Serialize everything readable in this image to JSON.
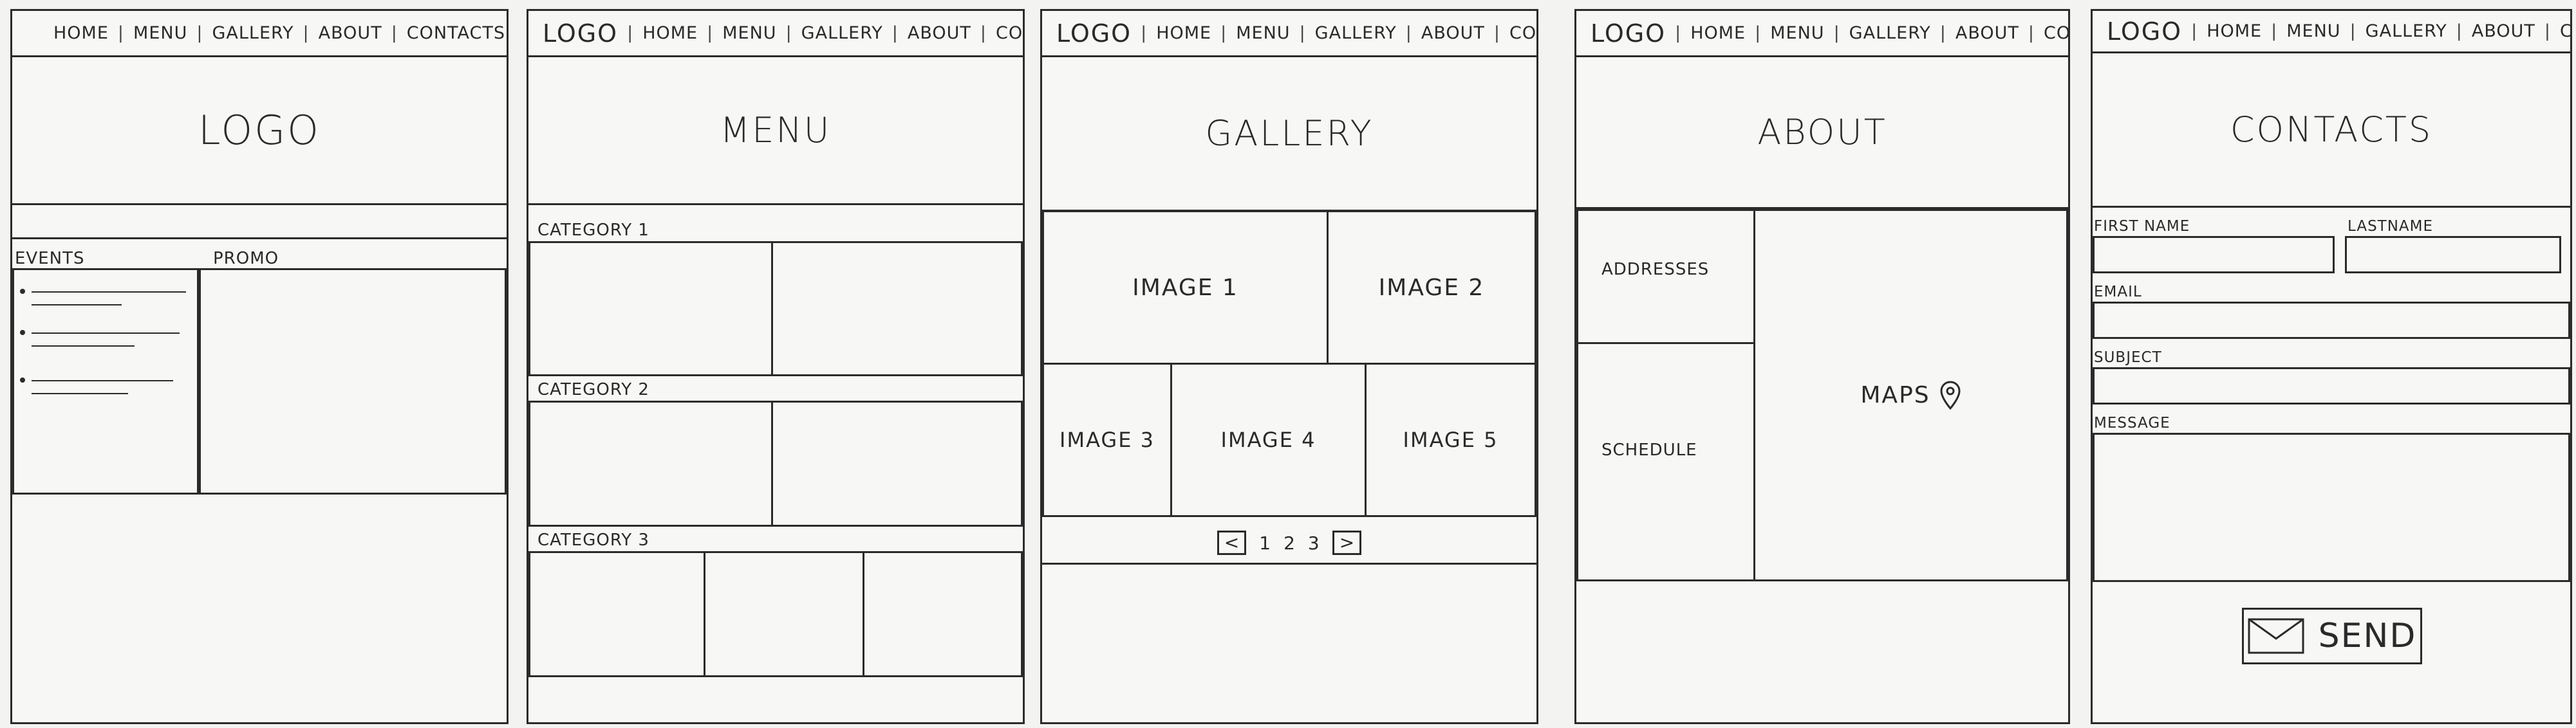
{
  "nav": {
    "logo": "LOGO",
    "home": "HOME",
    "menu": "MENU",
    "gallery": "GALLERY",
    "about": "ABOUT",
    "contacts": "CONTACTS",
    "sep": "|"
  },
  "home": {
    "hero": "LOGO",
    "events": "EVENTS",
    "promo": "PROMO"
  },
  "menu": {
    "hero": "MENU",
    "cat1": "CATEGORY 1",
    "cat2": "CATEGORY 2",
    "cat3": "CATEGORY 3"
  },
  "gallery": {
    "hero": "GALLERY",
    "images": [
      "IMAGE 1",
      "IMAGE 2",
      "IMAGE 3",
      "IMAGE 4",
      "IMAGE 5"
    ],
    "pager": {
      "prev": "<",
      "pages": [
        "1",
        "2",
        "3"
      ],
      "next": ">"
    }
  },
  "about": {
    "hero": "ABOUT",
    "addresses": "ADDRESSES",
    "schedule": "SCHEDULE",
    "maps": "MAPS"
  },
  "contacts": {
    "hero": "CONTACTS",
    "first_name": "FIRST NAME",
    "last_name": "LASTNAME",
    "email": "EMAIL",
    "subject": "SUBJECT",
    "message": "MESSAGE",
    "send": "SEND"
  },
  "icons": {
    "map_pin": "map-pin-icon",
    "envelope": "envelope-icon"
  }
}
